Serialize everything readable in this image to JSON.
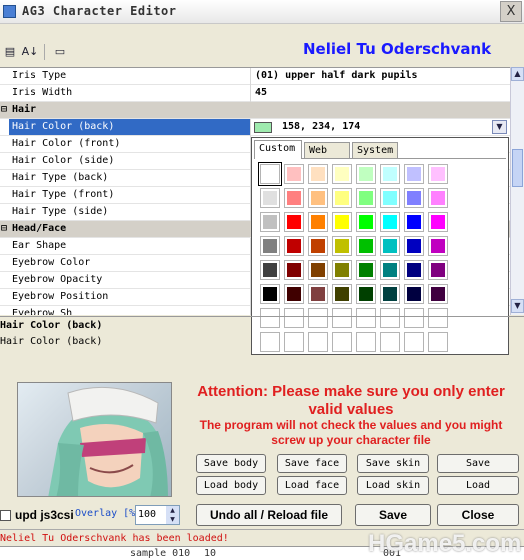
{
  "window": {
    "title": "AG3 Character Editor",
    "close_label": "X"
  },
  "toolbar": {
    "categorized_icon": "▤",
    "alpha_icon": "A↓",
    "pages_icon": "▭"
  },
  "character_name": "Neliel Tu Oderschvank",
  "properties": [
    {
      "label": "Iris Type",
      "value": "(01) upper half dark pupils",
      "kind": "prop"
    },
    {
      "label": "Iris Width",
      "value": "45",
      "kind": "prop"
    },
    {
      "label": "Hair",
      "value": "",
      "kind": "cat",
      "toggle": "⊟"
    },
    {
      "label": "Hair Color (back)",
      "value": "158, 234, 174",
      "kind": "sel"
    },
    {
      "label": "Hair Color (front)",
      "value": "",
      "kind": "prop"
    },
    {
      "label": "Hair Color (side)",
      "value": "",
      "kind": "prop"
    },
    {
      "label": "Hair Type (back)",
      "value": "",
      "kind": "prop"
    },
    {
      "label": "Hair Type (front)",
      "value": "",
      "kind": "prop"
    },
    {
      "label": "Hair Type (side)",
      "value": "",
      "kind": "prop"
    },
    {
      "label": "Head/Face",
      "value": "",
      "kind": "cat",
      "toggle": "⊟"
    },
    {
      "label": "Ear Shape",
      "value": "",
      "kind": "prop"
    },
    {
      "label": "Eyebrow Color",
      "value": "",
      "kind": "prop"
    },
    {
      "label": "Eyebrow Opacity",
      "value": "",
      "kind": "prop"
    },
    {
      "label": "Eyebrow Position",
      "value": "",
      "kind": "prop"
    },
    {
      "label": "Eyebrow Sh",
      "value": "",
      "kind": "prop"
    }
  ],
  "selected_color_hex": "#9eeaae",
  "color_picker": {
    "tabs": [
      "Custom",
      "Web",
      "System"
    ],
    "active_tab": "Custom",
    "colors": [
      [
        "#ffffff",
        "#ffc0c0",
        "#ffe0c0",
        "#ffffc0",
        "#c0ffc0",
        "#c0ffff",
        "#c0c0ff",
        "#ffc0ff"
      ],
      [
        "#e0e0e0",
        "#ff8080",
        "#ffc080",
        "#ffff80",
        "#80ff80",
        "#80ffff",
        "#8080ff",
        "#ff80ff"
      ],
      [
        "#c0c0c0",
        "#ff0000",
        "#ff8000",
        "#ffff00",
        "#00ff00",
        "#00ffff",
        "#0000ff",
        "#ff00ff"
      ],
      [
        "#808080",
        "#c00000",
        "#c04000",
        "#c0c000",
        "#00c000",
        "#00c0c0",
        "#0000c0",
        "#c000c0"
      ],
      [
        "#404040",
        "#800000",
        "#804000",
        "#808000",
        "#008000",
        "#008080",
        "#000080",
        "#800080"
      ],
      [
        "#000000",
        "#400000",
        "#804040",
        "#404000",
        "#004000",
        "#004040",
        "#000040",
        "#400040"
      ],
      [
        "#ffffff",
        "#ffffff",
        "#ffffff",
        "#ffffff",
        "#ffffff",
        "#ffffff",
        "#ffffff",
        "#ffffff"
      ],
      [
        "#ffffff",
        "#ffffff",
        "#ffffff",
        "#ffffff",
        "#ffffff",
        "#ffffff",
        "#ffffff",
        "#ffffff"
      ]
    ]
  },
  "description": {
    "title": "Hair Color (back)",
    "text": "Hair Color (back)"
  },
  "attention": {
    "line1": "Attention: Please make sure you only enter valid values",
    "line2": "The program will not check the values and you might screw up your character file"
  },
  "buttons": {
    "save_body": "Save body",
    "save_face": "Save face",
    "save_skin": "Save skin",
    "save": "Save",
    "load_body": "Load body",
    "load_face": "Load face",
    "load_skin": "Load skin",
    "load": "Load",
    "undo_reload": "Undo all / Reload file",
    "save_big": "Save",
    "close": "Close"
  },
  "footer": {
    "upd_label": "upd js3csi",
    "overlay_label": "Overlay [%]",
    "overlay_value": "100",
    "status": "Neliel Tu Oderschvank has been loaded!",
    "bottom_cells": [
      "sample 010",
      "10",
      "001"
    ],
    "watermark": "HGame5.com"
  }
}
